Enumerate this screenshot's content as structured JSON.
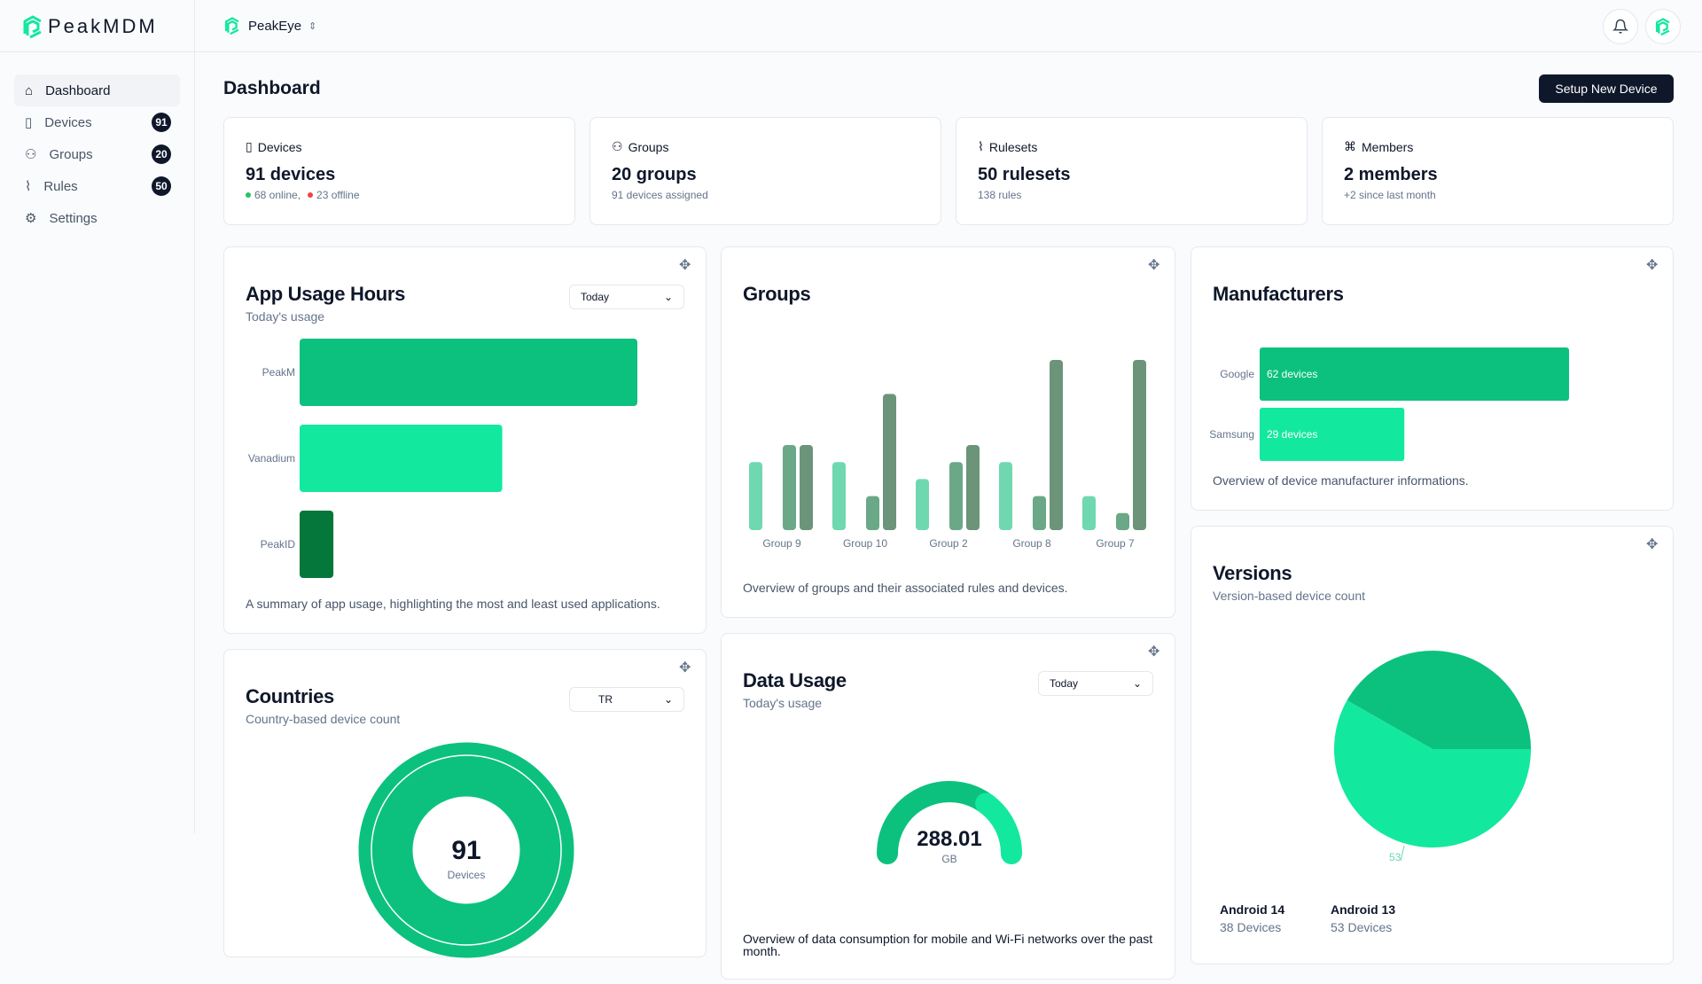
{
  "app": {
    "name": "PeakMDM",
    "workspace": "PeakEye"
  },
  "colors": {
    "primary": "#0cc17e",
    "light": "#13e89f",
    "dark": "#05773a",
    "navy": "#0f172a",
    "group_s1": "#6fd8b0",
    "group_s2": "#6aa888",
    "group_s3": "#6b9479"
  },
  "sidebar": {
    "items": [
      {
        "label": "Dashboard",
        "icon": "home-icon",
        "active": true
      },
      {
        "label": "Devices",
        "icon": "phone-icon",
        "badge": "91"
      },
      {
        "label": "Groups",
        "icon": "users-icon",
        "badge": "20"
      },
      {
        "label": "Rules",
        "icon": "paperclip-icon",
        "badge": "50"
      },
      {
        "label": "Settings",
        "icon": "gear-icon"
      }
    ]
  },
  "header": {
    "title": "Dashboard",
    "setup_label": "Setup New Device"
  },
  "stats": [
    {
      "label": "Devices",
      "value": "91 devices",
      "online": "68 online,",
      "offline": "23 offline"
    },
    {
      "label": "Groups",
      "value": "20 groups",
      "sub": "91 devices assigned"
    },
    {
      "label": "Rulesets",
      "value": "50 rulesets",
      "sub": "138 rules"
    },
    {
      "label": "Members",
      "value": "2 members",
      "sub": "+2 since last month"
    }
  ],
  "app_usage": {
    "title": "App Usage Hours",
    "subtitle": "Today's usage",
    "select": "Today",
    "description": "A summary of app usage, highlighting the most and least used applications."
  },
  "groups": {
    "title": "Groups",
    "description": "Overview of groups and their associated rules and devices."
  },
  "manufacturers": {
    "title": "Manufacturers",
    "description": "Overview of device manufacturer informations."
  },
  "countries": {
    "title": "Countries",
    "subtitle": "Country-based device count",
    "select": "TR",
    "center_value": "91",
    "center_label": "Devices"
  },
  "data_usage": {
    "title": "Data Usage",
    "subtitle": "Today's usage",
    "select": "Today",
    "value": "288.01",
    "unit": "GB",
    "description": "Overview of data consumption for mobile and Wi-Fi networks over the past month."
  },
  "versions": {
    "title": "Versions",
    "subtitle": "Version-based device count",
    "legend": [
      {
        "name": "Android 14",
        "count": "38 Devices"
      },
      {
        "name": "Android 13",
        "count": "53 Devices"
      }
    ],
    "slice_label": "53"
  },
  "chart_data": [
    {
      "type": "bar",
      "orientation": "horizontal",
      "categories": [
        "PeakM",
        "Vanadium",
        "PeakID"
      ],
      "values": [
        10,
        6,
        1
      ]
    },
    {
      "type": "bar",
      "categories": [
        "Group 9",
        "Group 10",
        "Group 2",
        "Group 8",
        "Group 7"
      ],
      "series": [
        {
          "values": [
            4,
            4,
            3,
            4,
            2
          ]
        },
        {
          "values": [
            5,
            2,
            4,
            2,
            1
          ]
        },
        {
          "values": [
            5,
            8,
            5,
            10,
            10
          ]
        }
      ]
    },
    {
      "type": "bar",
      "orientation": "horizontal",
      "categories": [
        "Google",
        "Samsung"
      ],
      "values": [
        62,
        29
      ],
      "labels": [
        "62 devices",
        "29 devices"
      ]
    },
    {
      "type": "pie",
      "categories": [
        "TR"
      ],
      "values": [
        91
      ]
    },
    {
      "type": "gauge",
      "segments": [
        0.7,
        0.3
      ]
    },
    {
      "type": "pie",
      "categories": [
        "Android 14",
        "Android 13"
      ],
      "values": [
        38,
        53
      ]
    }
  ]
}
